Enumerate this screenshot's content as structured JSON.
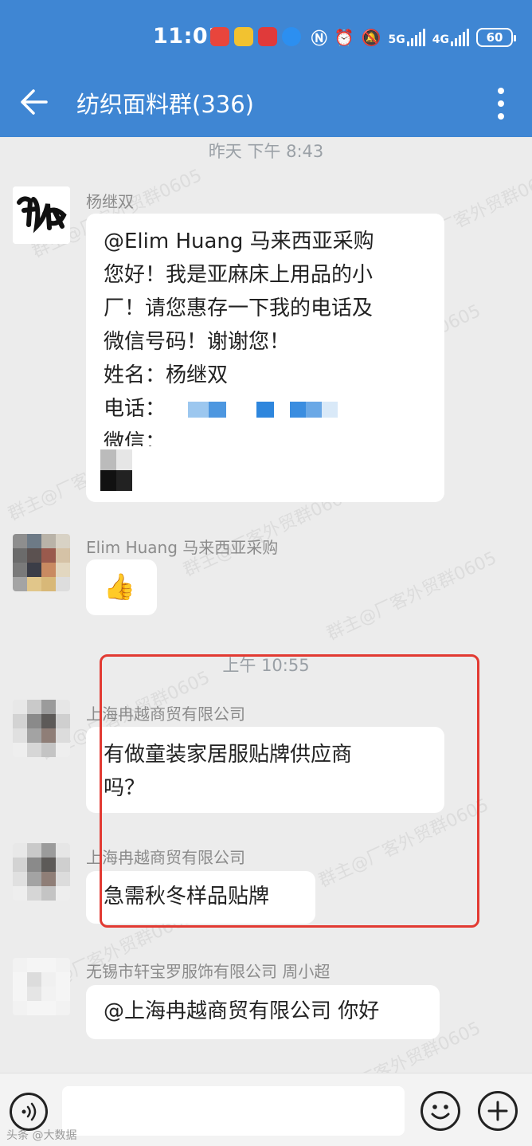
{
  "status_bar": {
    "time": "11:01",
    "signal_5g": "5G",
    "signal_4g": "4G",
    "battery": "60"
  },
  "header": {
    "title": "纺织面料群(336)"
  },
  "chat": {
    "timestamp1": "昨天 下午 8:43",
    "msg1": {
      "sender": "杨继双",
      "lines": [
        "@Elim Huang  马来西亚采购",
        "您好！我是亚麻床上用品的小",
        "厂！请您惠存一下我的电话及",
        "微信号码！谢谢您！",
        "姓名：杨继双",
        "电话：",
        "微信："
      ]
    },
    "msg2": {
      "sender": "Elim Huang  马来西亚采购",
      "emoji": "👍"
    },
    "timestamp2": "上午 10:55",
    "msg3": {
      "sender": "上海冉越商贸有限公司",
      "lines": [
        "有做童装家居服贴牌供应商",
        "吗？"
      ]
    },
    "msg4": {
      "sender": "上海冉越商贸有限公司",
      "text": "急需秋冬样品贴牌"
    },
    "msg5": {
      "sender": "无锡市轩宝罗服饰有限公司 周小超",
      "text": "@上海冉越商贸有限公司 你好"
    }
  },
  "watermark": "群主@厂客外贸群0605",
  "bottom_mark": "头条 @大数据",
  "colors": {
    "header_bg": "#3f86d3",
    "highlight_box": "#e23a32",
    "chat_bg": "#ececec"
  },
  "icons": [
    "back-arrow-icon",
    "more-vertical-icon",
    "voice-icon",
    "emoji-icon",
    "plus-icon",
    "thumbs-up-icon"
  ]
}
